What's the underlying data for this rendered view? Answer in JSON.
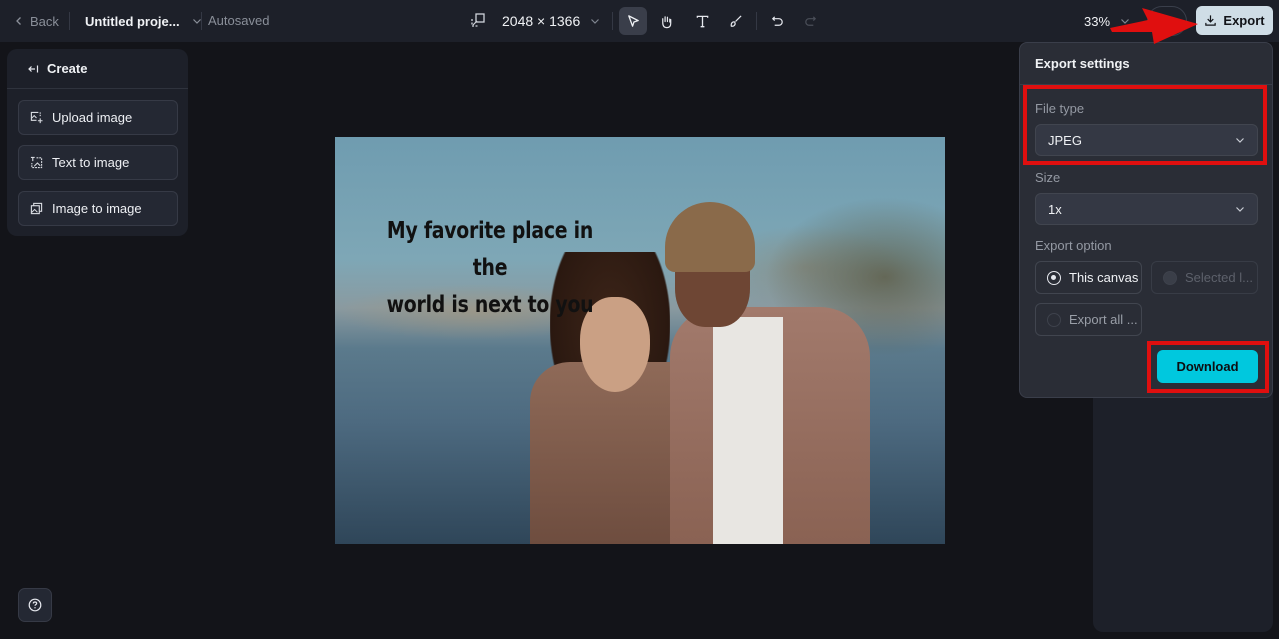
{
  "header": {
    "back_label": "Back",
    "project_title": "Untitled proje...",
    "save_status": "Autosaved",
    "canvas_dimensions": "2048 × 1366",
    "zoom_level": "33%",
    "export_label": "Export",
    "tools": [
      {
        "name": "select",
        "icon": "cursor-arrow-icon",
        "active": true
      },
      {
        "name": "pan",
        "icon": "hand-icon",
        "active": false
      },
      {
        "name": "text",
        "icon": "text-t-icon",
        "active": false
      },
      {
        "name": "brush",
        "icon": "brush-icon",
        "active": false
      },
      {
        "name": "undo",
        "icon": "undo-icon",
        "active": false
      },
      {
        "name": "redo",
        "icon": "redo-icon",
        "active": false,
        "disabled": true
      }
    ]
  },
  "left_panel": {
    "title": "Create",
    "items": [
      {
        "label": "Upload image",
        "icon": "upload-image-icon"
      },
      {
        "label": "Text to image",
        "icon": "text-to-image-icon"
      },
      {
        "label": "Image to image",
        "icon": "image-to-image-icon"
      }
    ]
  },
  "canvas": {
    "text_overlay_line1": "My favorite place in the",
    "text_overlay_line2": "world is next to you",
    "image_description": "Two people embracing by a lake with blurred mountains"
  },
  "export_settings": {
    "title": "Export settings",
    "file_type_label": "File type",
    "file_type_value": "JPEG",
    "size_label": "Size",
    "size_value": "1x",
    "export_option_label": "Export option",
    "options": [
      {
        "label": "This canvas",
        "selected": true,
        "disabled": false
      },
      {
        "label": "Selected l...",
        "selected": false,
        "disabled": true
      },
      {
        "label": "Export all ...",
        "selected": false,
        "disabled": false
      }
    ],
    "download_label": "Download"
  },
  "colors": {
    "accent_download": "#00c8de",
    "annotation_red": "#e00f0f",
    "export_button_bg": "#cfdde6"
  }
}
